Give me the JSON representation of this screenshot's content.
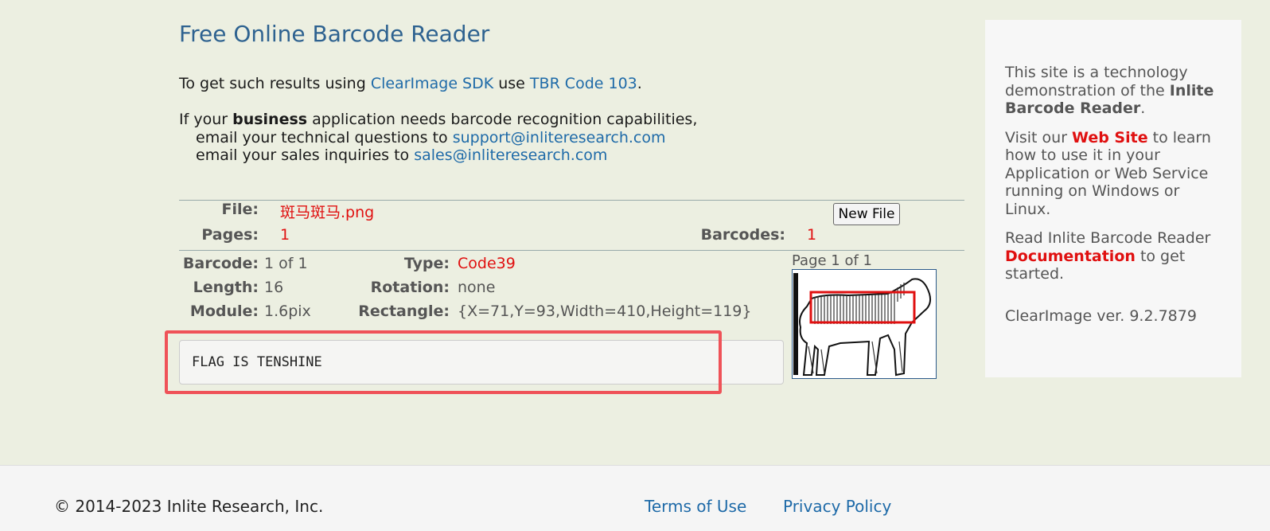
{
  "page": {
    "title": "Free Online Barcode Reader",
    "intro": {
      "prefix": "To get such results using ",
      "sdk_link": "ClearImage SDK",
      "mid": " use ",
      "code_link": "TBR Code 103",
      "suffix": "."
    },
    "business": {
      "prefix": "If your ",
      "bold": "business",
      "suffix": " application needs barcode recognition capabilities,",
      "tech_prefix": "email your technical questions to ",
      "tech_email": "support@inliteresearch.com",
      "sales_prefix": "email your sales inquiries to ",
      "sales_email": "sales@inliteresearch.com"
    }
  },
  "file_info": {
    "file_label": "File:",
    "file_name": "斑马斑马.png",
    "new_file_button": "New File",
    "pages_label": "Pages:",
    "pages_value": "1",
    "barcodes_label": "Barcodes:",
    "barcodes_value": "1"
  },
  "barcode": {
    "barcode_label": "Barcode:",
    "barcode_value": "1 of 1",
    "type_label": "Type:",
    "type_value": "Code39",
    "length_label": "Length:",
    "length_value": "16",
    "rotation_label": "Rotation:",
    "rotation_value": "none",
    "module_label": "Module:",
    "module_value": "1.6pix",
    "rectangle_label": "Rectangle:",
    "rectangle_value": "{X=71,Y=93,Width=410,Height=119}",
    "result_text": "FLAG IS TENSHINE",
    "page_label": "Page 1 of 1"
  },
  "sidebar": {
    "p1_prefix": "This site is a technology demonstration of the ",
    "p1_bold": "Inlite Barcode Reader",
    "p1_suffix": ".",
    "p2_prefix": "Visit our ",
    "p2_link": "Web Site",
    "p2_suffix": " to learn how to use it in your Application or Web Service running on Windows or Linux.",
    "p3_prefix": "Read Inlite Barcode Reader ",
    "p3_link": "Documentation",
    "p3_suffix": " to get started.",
    "version": "ClearImage ver. 9.2.7879"
  },
  "footer": {
    "copyright": "© 2014-2023 Inlite Research, Inc.",
    "terms": "Terms of Use",
    "privacy": "Privacy Policy"
  },
  "colors": {
    "background": "#ecefe1",
    "title": "#2e6290",
    "link": "#1e6aa8",
    "value_red": "#e01010",
    "highlight": "#ef5258"
  }
}
